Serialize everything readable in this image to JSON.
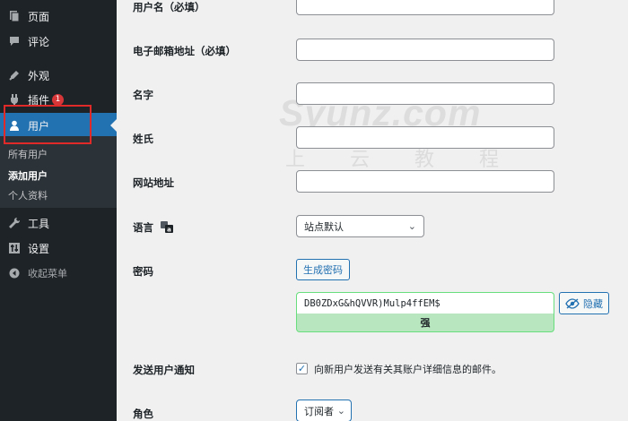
{
  "sidebar": {
    "items": [
      {
        "label": "页面",
        "icon": "pages-icon"
      },
      {
        "label": "评论",
        "icon": "comments-icon"
      },
      {
        "label": "外观",
        "icon": "appearance-icon"
      },
      {
        "label": "插件",
        "icon": "plugins-icon",
        "badge": "1"
      },
      {
        "label": "用户",
        "icon": "users-icon",
        "active": true
      },
      {
        "label": "工具",
        "icon": "tools-icon"
      },
      {
        "label": "设置",
        "icon": "settings-icon"
      },
      {
        "label": "收起菜单",
        "icon": "collapse-icon"
      }
    ],
    "submenu": [
      "所有用户",
      "添加用户",
      "个人资料"
    ]
  },
  "form": {
    "username_label": "用户名（必填）",
    "email_label": "电子邮箱地址（必填）",
    "firstname_label": "名字",
    "lastname_label": "姓氏",
    "website_label": "网站地址",
    "language_label": "语言",
    "language_value": "站点默认",
    "password_label": "密码",
    "generate_password_label": "生成密码",
    "password_value": "DB0ZDxG&hQVVR)Mulp4ffEM$",
    "hide_label": "隐藏",
    "strength_label": "强",
    "notify_label": "发送用户通知",
    "notify_text": "向新用户发送有关其账户详细信息的邮件。",
    "notify_checked": true,
    "role_label": "角色",
    "role_value": "订阅者"
  },
  "watermark": {
    "line1": "Syunz.com",
    "line2": "上云教程"
  },
  "colors": {
    "sidebar_bg": "#1d2327",
    "accent": "#2271b1",
    "badge": "#d63638",
    "strength_bg": "#b8e6bf",
    "highlight": "#e02a2a"
  }
}
